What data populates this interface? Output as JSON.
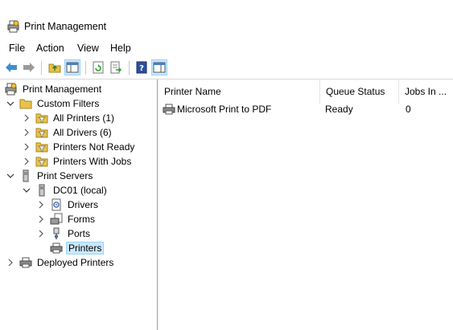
{
  "window": {
    "title": "Print Management"
  },
  "menu": [
    "File",
    "Action",
    "View",
    "Help"
  ],
  "tree": {
    "root": "Print Management",
    "custom_filters": "Custom Filters",
    "all_printers": "All Printers (1)",
    "all_drivers": "All Drivers (6)",
    "printers_not_ready": "Printers Not Ready",
    "printers_with_jobs": "Printers With Jobs",
    "print_servers": "Print Servers",
    "server": "DC01 (local)",
    "drivers": "Drivers",
    "forms": "Forms",
    "ports": "Ports",
    "printers": "Printers",
    "deployed_printers": "Deployed Printers"
  },
  "list": {
    "columns": [
      "Printer Name",
      "Queue Status",
      "Jobs In ..."
    ],
    "rows": [
      {
        "name": "Microsoft Print to PDF",
        "status": "Ready",
        "jobs": "0"
      }
    ]
  },
  "colors": {
    "selection_bg": "#cce8ff",
    "selection_border": "#99d1ff"
  }
}
